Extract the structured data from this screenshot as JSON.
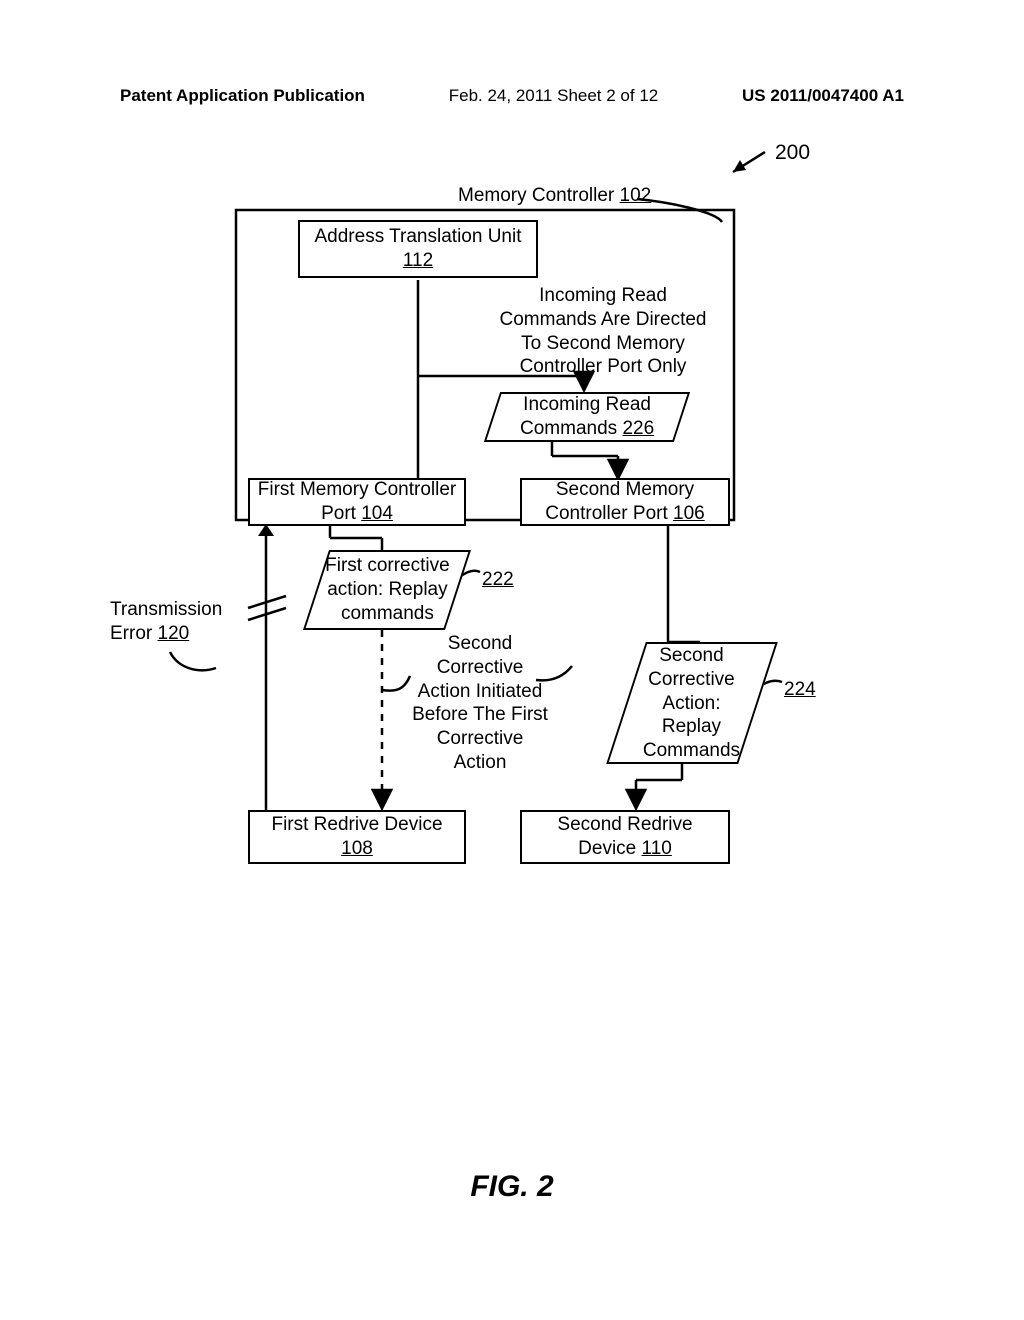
{
  "header": {
    "left": "Patent Application Publication",
    "center": "Feb. 24, 2011  Sheet 2 of 12",
    "right": "US 2011/0047400 A1"
  },
  "figure": {
    "ref_200": "200",
    "mem_controller_label": "Memory Controller ",
    "mem_controller_ref": "102",
    "atu_label": "Address Translation Unit\n",
    "atu_ref": "112",
    "incoming_note": "Incoming Read\nCommands Are Directed\nTo Second Memory\nController Port Only",
    "incoming_box_label": "Incoming Read\nCommands ",
    "incoming_box_ref": "226",
    "first_port_label": "First Memory Controller\nPort ",
    "first_port_ref": "104",
    "second_port_label": "Second Memory\nController Port ",
    "second_port_ref": "106",
    "first_corrective_label": "First corrective\naction: Replay\ncommands",
    "first_corrective_ref": "222",
    "trans_err_label": "Transmission\nError ",
    "trans_err_ref": "120",
    "second_note": "Second\nCorrective\nAction Initiated\nBefore The First\nCorrective\nAction",
    "second_corrective_label": "Second\nCorrective\nAction:\nReplay\nCommands",
    "second_corrective_ref": "224",
    "first_redrive_label": "First Redrive\nDevice ",
    "first_redrive_ref": "108",
    "second_redrive_label": "Second Redrive\nDevice ",
    "second_redrive_ref": "110",
    "caption": "FIG. 2"
  }
}
